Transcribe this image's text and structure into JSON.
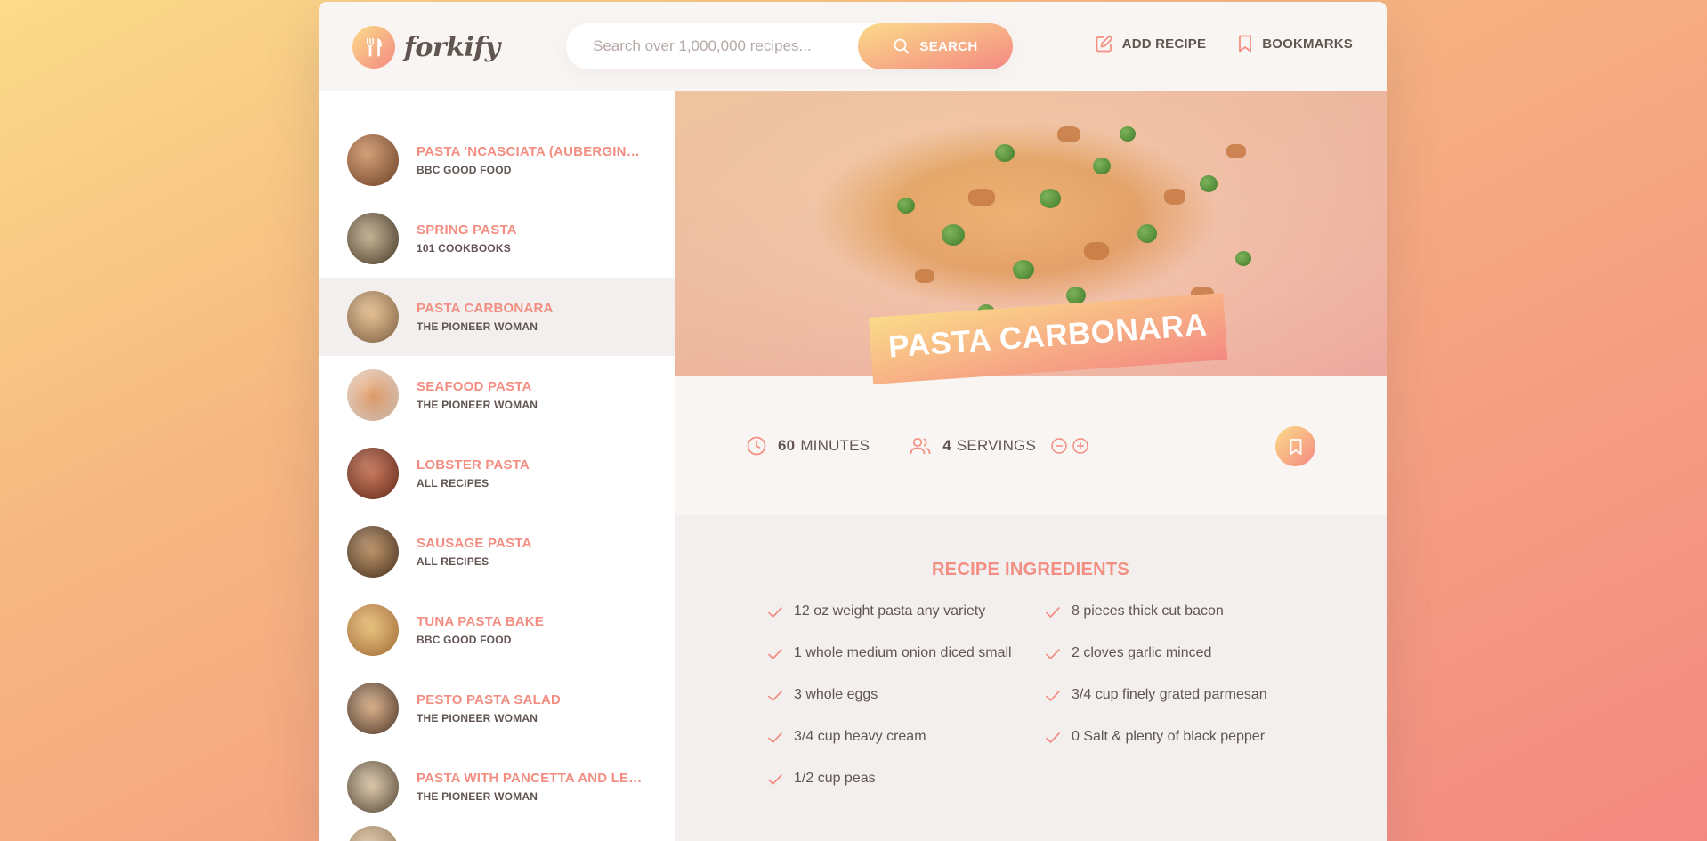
{
  "header": {
    "logo_text": "forkify",
    "search": {
      "placeholder": "Search over 1,000,000 recipes...",
      "value": "",
      "button_label": "SEARCH"
    },
    "nav": {
      "add_recipe": "ADD RECIPE",
      "bookmarks": "BOOKMARKS"
    }
  },
  "results": [
    {
      "title": "PASTA 'NCASCIATA (AUBERGINE ...",
      "publisher": "BBC GOOD FOOD"
    },
    {
      "title": "SPRING PASTA",
      "publisher": "101 COOKBOOKS"
    },
    {
      "title": "PASTA CARBONARA",
      "publisher": "THE PIONEER WOMAN"
    },
    {
      "title": "SEAFOOD PASTA",
      "publisher": "THE PIONEER WOMAN"
    },
    {
      "title": "LOBSTER PASTA",
      "publisher": "ALL RECIPES"
    },
    {
      "title": "SAUSAGE PASTA",
      "publisher": "ALL RECIPES"
    },
    {
      "title": "TUNA PASTA BAKE",
      "publisher": "BBC GOOD FOOD"
    },
    {
      "title": "PESTO PASTA SALAD",
      "publisher": "THE PIONEER WOMAN"
    },
    {
      "title": "PASTA WITH PANCETTA AND LEE...",
      "publisher": "THE PIONEER WOMAN"
    }
  ],
  "active_result_index": 2,
  "recipe": {
    "title": "PASTA CARBONARA",
    "minutes": "60",
    "minutes_label": "MINUTES",
    "servings": "4",
    "servings_label": "SERVINGS",
    "ingredients_heading": "RECIPE INGREDIENTS",
    "ingredients": [
      "12 oz weight pasta any variety",
      "8 pieces thick cut bacon",
      "1 whole medium onion diced small",
      "2 cloves garlic minced",
      "3 whole eggs",
      "3/4 cup finely grated parmesan",
      "3/4 cup heavy cream",
      "0 Salt & plenty of black pepper",
      "1/2 cup peas"
    ]
  },
  "colors": {
    "accent": "#f38e82",
    "gradient_start": "#fbdb89",
    "gradient_end": "#f48982",
    "text": "#615551"
  }
}
